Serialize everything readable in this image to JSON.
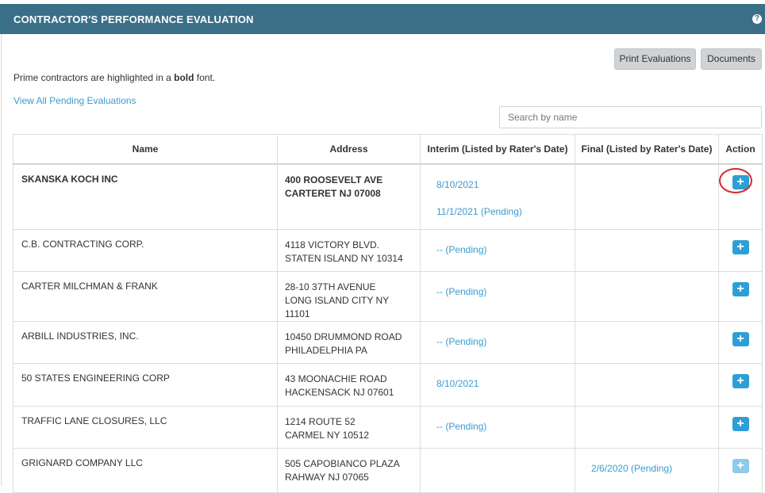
{
  "header": {
    "title": "CONTRACTOR'S PERFORMANCE EVALUATION",
    "help_glyph": "?"
  },
  "toolbar": {
    "print_label": "Print Evaluations",
    "documents_label": "Documents"
  },
  "note": {
    "prefix": "Prime contractors are highlighted in a ",
    "bold_word": "bold",
    "suffix": " font."
  },
  "pending_link": "View All Pending Evaluations",
  "search": {
    "placeholder": "Search by name",
    "value": ""
  },
  "table": {
    "columns": [
      "Name",
      "Address",
      "Interim (Listed by Rater's Date)",
      "Final (Listed by Rater's Date)",
      "Action"
    ],
    "rows": [
      {
        "name": "SKANSKA KOCH INC",
        "addr1": "400 ROOSEVELT AVE",
        "addr2": "CARTERET  NJ 07008",
        "interim1": "8/10/2021",
        "interim2": "11/1/2021 (Pending)",
        "final": "",
        "bold": true
      },
      {
        "name": "C.B. CONTRACTING CORP.",
        "addr1": "4118 VICTORY BLVD.",
        "addr2": "STATEN ISLAND  NY 10314",
        "interim1": "-- (Pending)",
        "interim2": "",
        "final": "",
        "bold": false
      },
      {
        "name": "CARTER MILCHMAN & FRANK",
        "addr1": "28-10 37TH AVENUE",
        "addr2": "LONG ISLAND CITY  NY 11101",
        "interim1": "-- (Pending)",
        "interim2": "",
        "final": "",
        "bold": false
      },
      {
        "name": "ARBILL INDUSTRIES, INC.",
        "addr1": "10450 DRUMMOND ROAD",
        "addr2": "PHILADELPHIA  PA",
        "interim1": "-- (Pending)",
        "interim2": "",
        "final": "",
        "bold": false
      },
      {
        "name": "50 STATES ENGINEERING CORP",
        "addr1": "43 MOONACHIE ROAD",
        "addr2": "HACKENSACK  NJ 07601",
        "interim1": "8/10/2021",
        "interim2": "",
        "final": "",
        "bold": false
      },
      {
        "name": "TRAFFIC LANE CLOSURES, LLC",
        "addr1": "1214 ROUTE 52",
        "addr2": "CARMEL  NY 10512",
        "interim1": "-- (Pending)",
        "interim2": "",
        "final": "",
        "bold": false
      },
      {
        "name": "GRIGNARD COMPANY LLC",
        "addr1": "505 CAPOBIANCO PLAZA",
        "addr2": "RAHWAY  NJ 07065",
        "interim1": "",
        "interim2": "",
        "final": "2/6/2020 (Pending)",
        "bold": false
      }
    ],
    "action_glyph": "+"
  },
  "colors": {
    "header_bg": "#3b6f88",
    "link": "#3a9bd1",
    "action_button": "#2e9fd6",
    "highlight_circle": "#d42a2a"
  }
}
